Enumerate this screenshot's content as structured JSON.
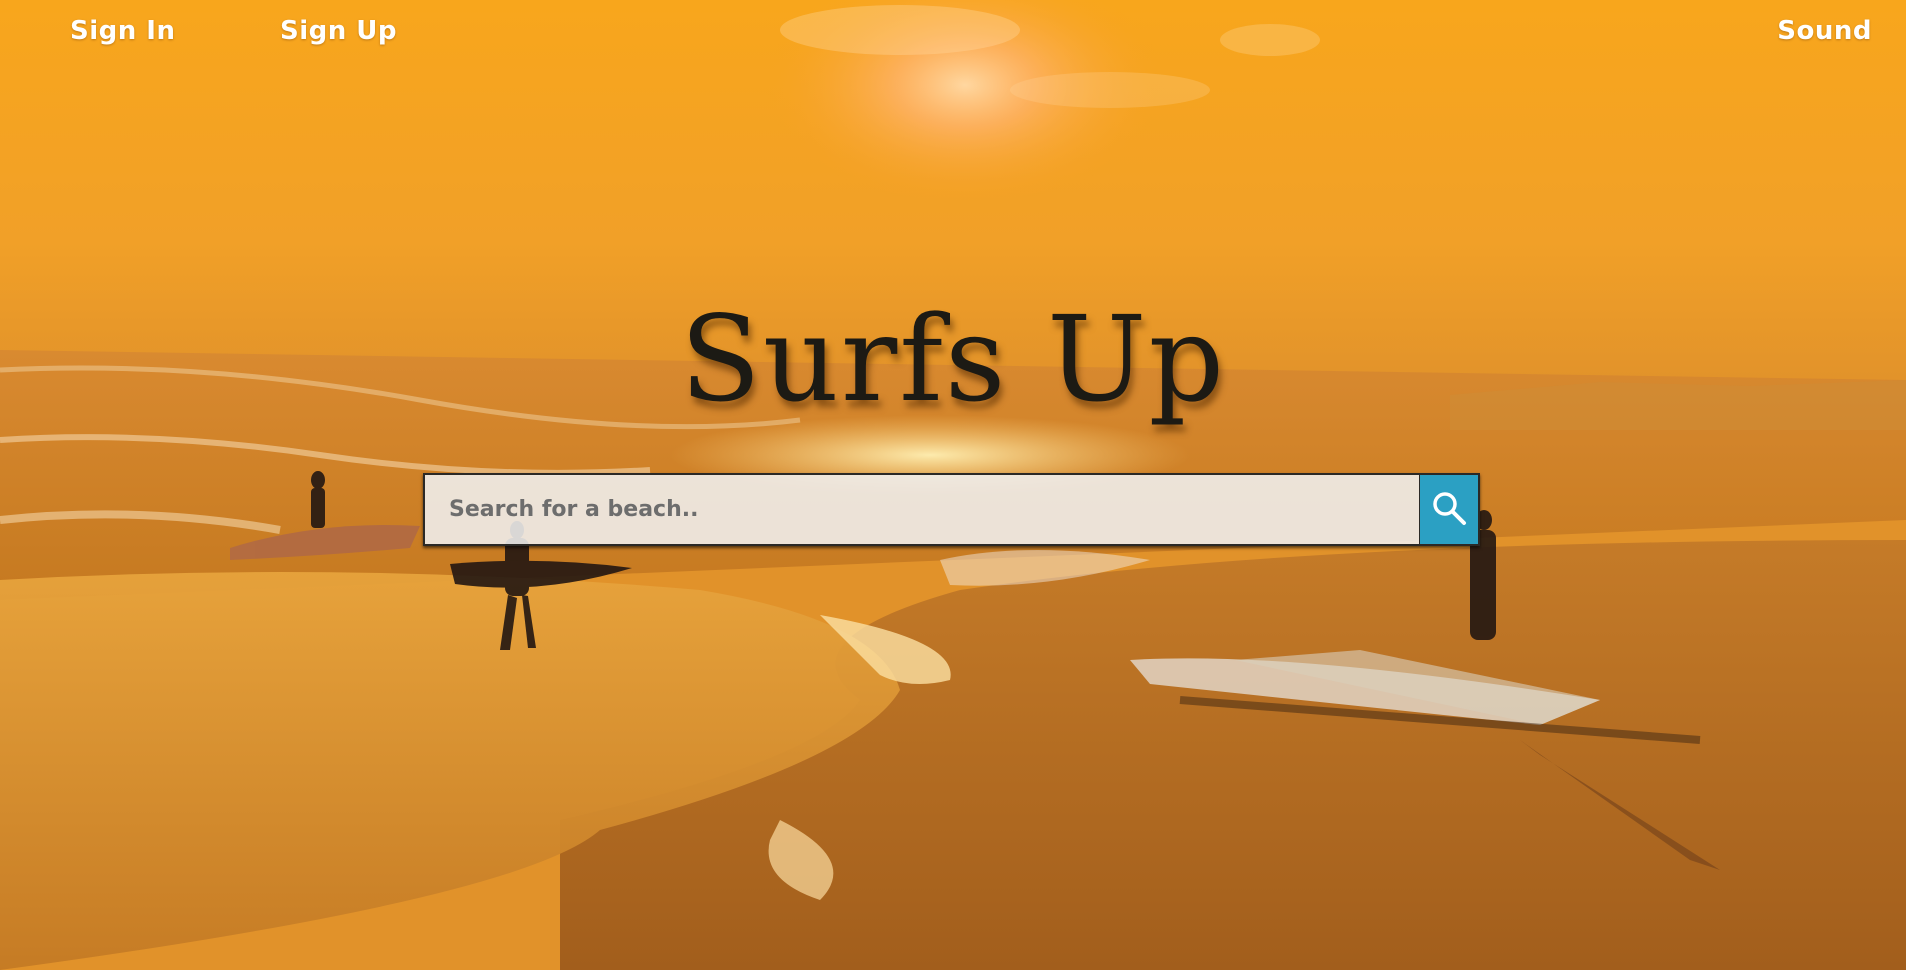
{
  "nav": {
    "sign_in": "Sign In",
    "sign_up": "Sign Up",
    "sound": "Sound"
  },
  "hero": {
    "title": "Surfs Up",
    "background_image": "sunset-beach-surfers"
  },
  "search": {
    "placeholder": "Search for a beach..",
    "value": "",
    "button_icon": "magnifier-icon"
  },
  "colors": {
    "sky_top": "#f5a21a",
    "sand": "#b06a1c",
    "title_text": "#1c1a14",
    "search_button": "#2ba0c3",
    "nav_text": "#ffffff"
  }
}
